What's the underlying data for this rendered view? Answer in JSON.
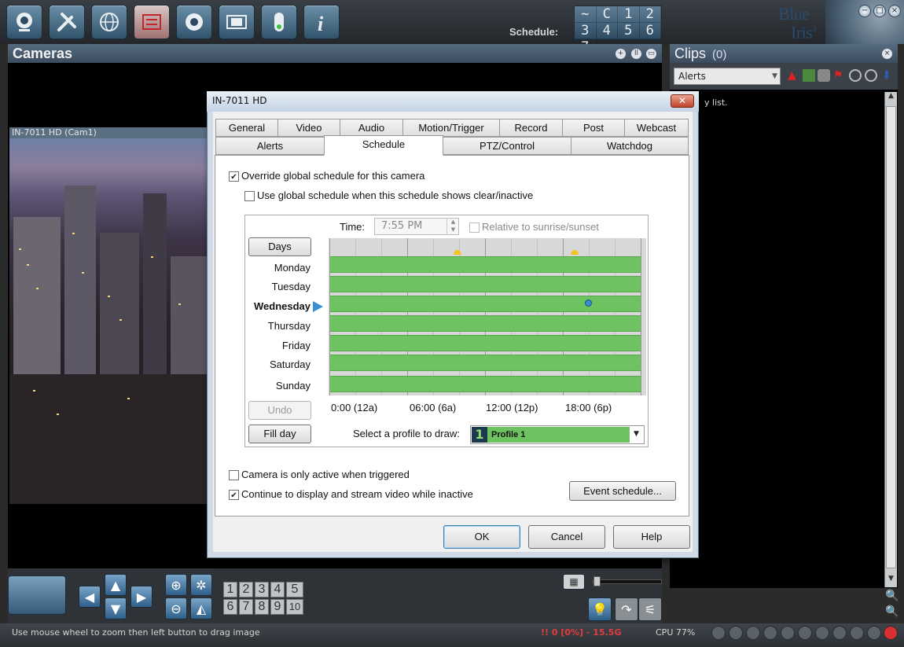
{
  "toolbar": {
    "buttons": [
      {
        "icon": "webcam-icon"
      },
      {
        "icon": "tools-icon"
      },
      {
        "icon": "globe-icon"
      },
      {
        "icon": "list-icon"
      },
      {
        "icon": "shutter-icon"
      },
      {
        "icon": "filmstrip-icon"
      },
      {
        "icon": "traffic-light-icon"
      },
      {
        "icon": "info-icon"
      }
    ],
    "schedule_label": "Schedule:",
    "schedule_cycle_glyph": "C",
    "schedule_tilde": "~",
    "schedule_numbers": [
      "1",
      "2",
      "3",
      "4",
      "5",
      "6",
      "7"
    ],
    "logo_line1": "Blue",
    "logo_line2": "Iris",
    "logo_sup": "3",
    "window_controls": [
      "−",
      "□",
      "×"
    ]
  },
  "cameras": {
    "title": "Cameras",
    "camera_title": "IN-7011 HD (Cam1)"
  },
  "camera_controls": {
    "number_keys": [
      "1",
      "2",
      "3",
      "4",
      "5",
      "6",
      "7",
      "8",
      "9",
      "10"
    ]
  },
  "clips": {
    "title": "Clips",
    "count": "(0)",
    "filter_value": "Alerts",
    "empty_text_fragment": "y list."
  },
  "status": {
    "hint": "Use mouse wheel to zoom then left button to drag image",
    "alert": "!! 0 [0%] - 15.5G",
    "cpu": "CPU 77%"
  },
  "dialog": {
    "title": "IN-7011 HD",
    "close_glyph": "✕",
    "tabs_row1": [
      "General",
      "Video",
      "Audio",
      "Motion/Trigger",
      "Record",
      "Post",
      "Webcast"
    ],
    "tabs_row2": [
      "Alerts",
      "Schedule",
      "PTZ/Control",
      "Watchdog"
    ],
    "selected_tab": "Schedule",
    "override_label": "Override global schedule for this camera",
    "override_checked": true,
    "use_global_label": "Use global schedule when this schedule shows clear/inactive",
    "use_global_checked": false,
    "time_label": "Time:",
    "time_value": "7:55 PM",
    "relative_label": "Relative to sunrise/sunset",
    "relative_checked": false,
    "days_button": "Days",
    "days": [
      "Monday",
      "Tuesday",
      "Wednesday",
      "Thursday",
      "Friday",
      "Saturday",
      "Sunday"
    ],
    "current_day": "Wednesday",
    "time_axis": [
      "0:00 (12a)",
      "06:00 (6a)",
      "12:00 (12p)",
      "18:00 (6p)"
    ],
    "undo_button": "Undo",
    "fill_day_button": "Fill day",
    "profile_prompt": "Select a profile to draw:",
    "profile_number": "1",
    "profile_value": "Profile 1",
    "triggered_label": "Camera is only active when triggered",
    "triggered_checked": false,
    "continue_label": "Continue to display and stream video while inactive",
    "continue_checked": true,
    "event_schedule_button": "Event schedule...",
    "ok_button": "OK",
    "cancel_button": "Cancel",
    "help_button": "Help",
    "colors": {
      "schedule_green": "#6dc35f",
      "current_day_marker": "#3a8fd1"
    }
  }
}
